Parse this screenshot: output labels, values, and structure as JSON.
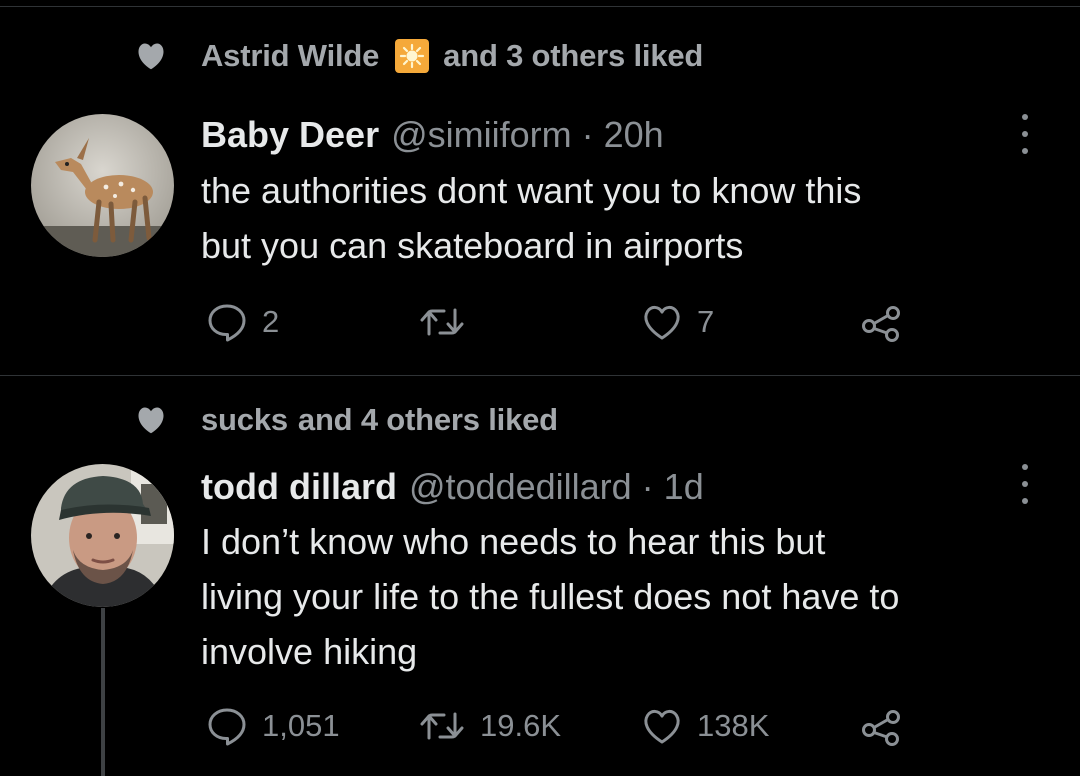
{
  "tweets": [
    {
      "social_context": {
        "liker": "Astrid Wilde",
        "suffix": "and 3 others liked",
        "badge_icon": "sun-emoji-icon"
      },
      "author": {
        "name": "Baby Deer",
        "handle": "@simiiform",
        "separator": "·",
        "time": "20h"
      },
      "avatar_icon": "fawn-avatar",
      "text_lines": [
        "the authorities dont want you to know this",
        "but you can skateboard in airports"
      ],
      "stats": {
        "replies": "2",
        "retweets": "",
        "likes": "7"
      }
    },
    {
      "social_context": {
        "liker": "sucks",
        "suffix": "and 4 others liked"
      },
      "author": {
        "name": "todd dillard",
        "handle": "@toddedillard",
        "separator": "·",
        "time": "1d"
      },
      "avatar_icon": "man-with-cap-avatar",
      "text_lines": [
        "I don’t know who needs to hear this but",
        "living your life to the fullest does not have to",
        "involve hiking"
      ],
      "stats": {
        "replies": "1,051",
        "retweets": "19.6K",
        "likes": "138K"
      }
    }
  ],
  "colors": {
    "background": "#000000",
    "text": "#e7e9ea",
    "muted": "#8b9095",
    "social": "#a4a8ac",
    "divider": "#2f3336"
  }
}
